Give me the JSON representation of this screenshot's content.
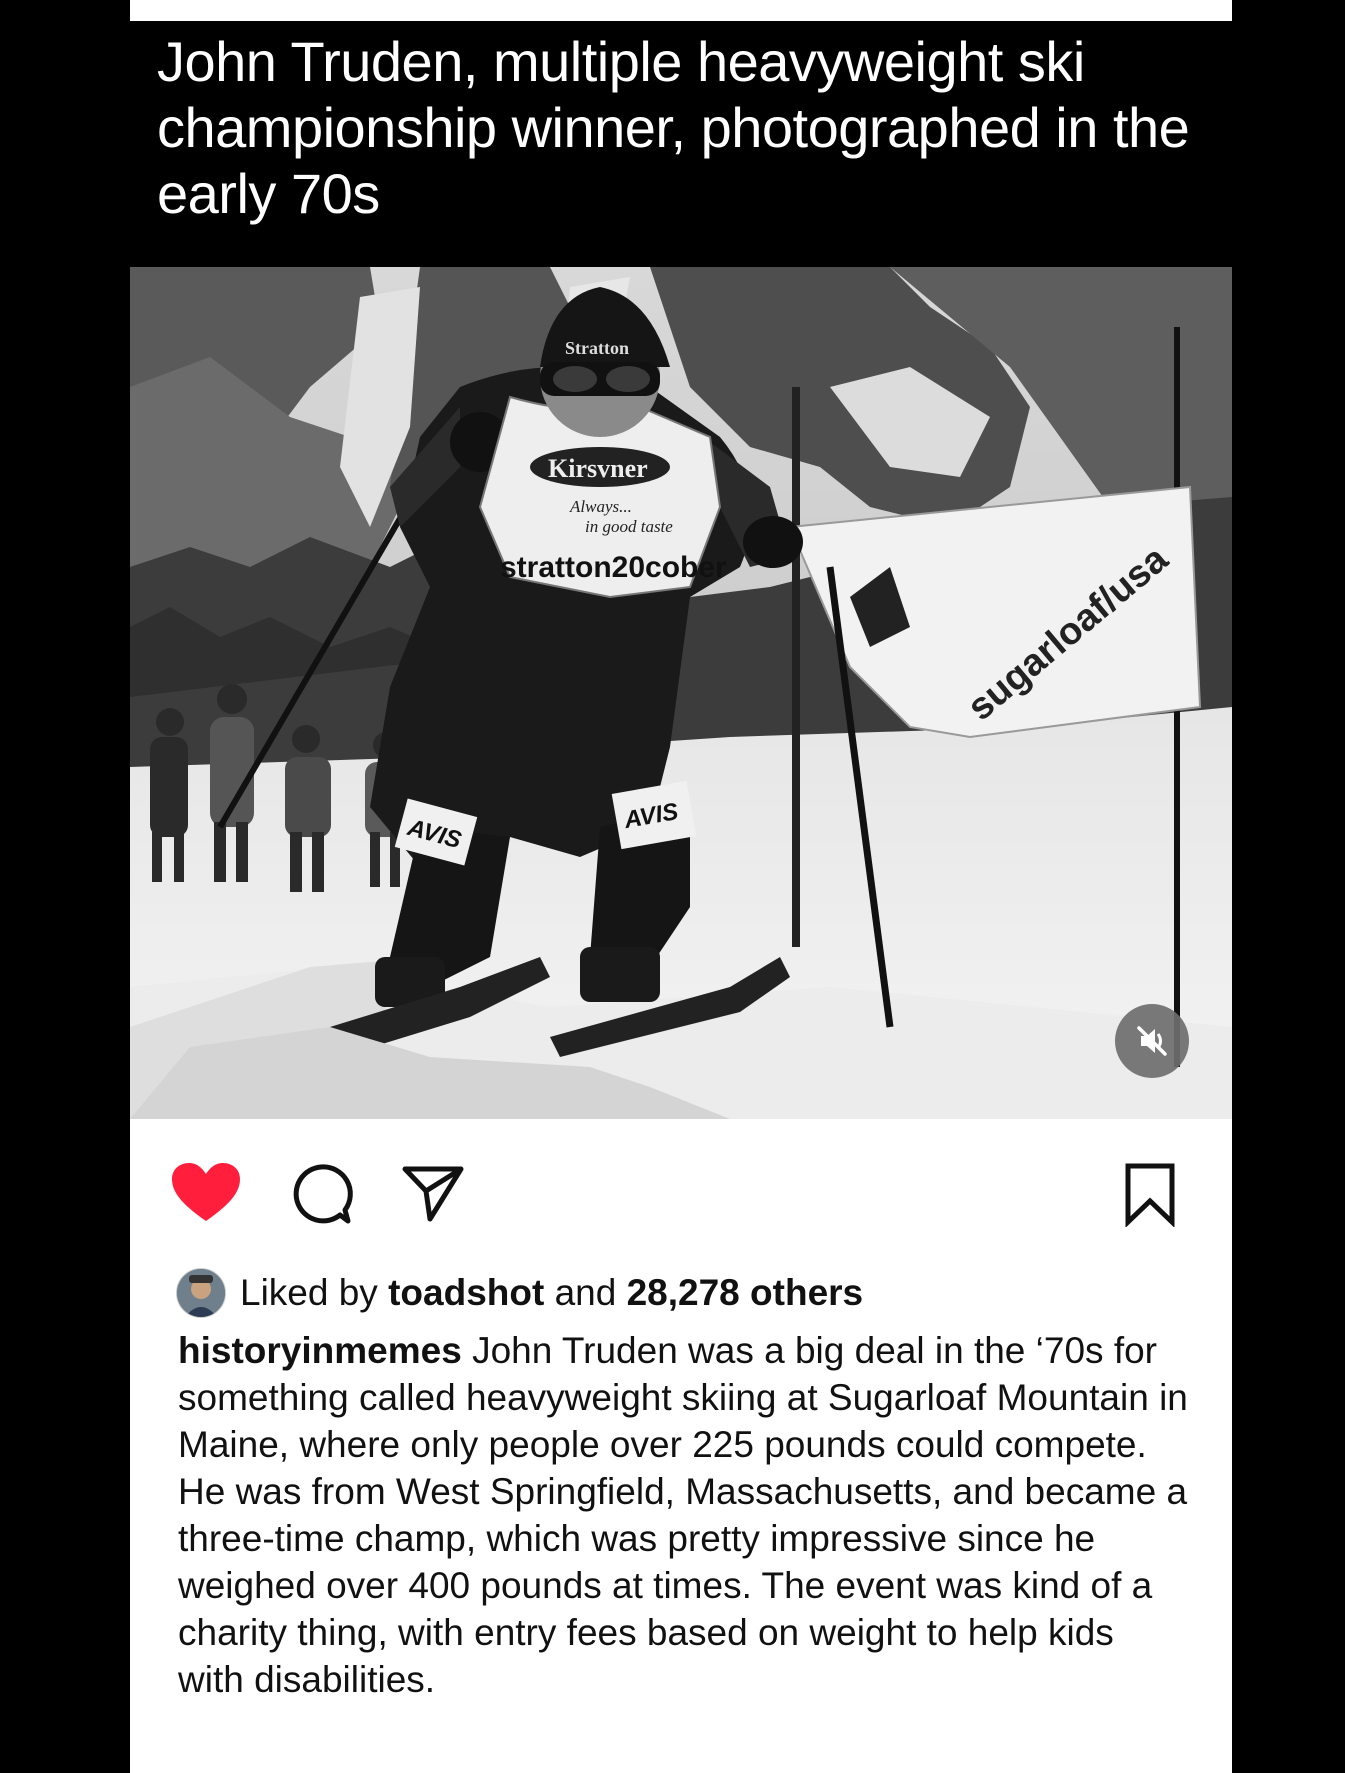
{
  "overlay_caption": "John Truden, multiple heavyweight ski championship winner, photographed in the early 70s",
  "photo": {
    "hat_text": "Stratton",
    "bib_brand": "Kirsvner",
    "bib_slogan_1": "Always...",
    "bib_slogan_2": "in good taste",
    "bib_event": "stratton20cober",
    "knee_patch": "AVIS",
    "banner_text": "sugarloaf/usa"
  },
  "actions": {
    "like_color": "#ff1f3d"
  },
  "likes": {
    "prefix": "Liked by",
    "user": "toadshot",
    "middle": "and",
    "others": "28,278 others"
  },
  "post": {
    "username": "historyinmemes",
    "caption": "John Truden was a big deal in the ‘70s for something called heavyweight skiing at Sugarloaf Mountain in Maine, where only people over 225 pounds could compete. He was from West Springfield, Massachusetts, and became a three-time champ, which was pretty impressive since he weighed over 400 pounds at times. The event was kind of a charity thing, with entry fees based on weight to help kids with disabilities."
  }
}
